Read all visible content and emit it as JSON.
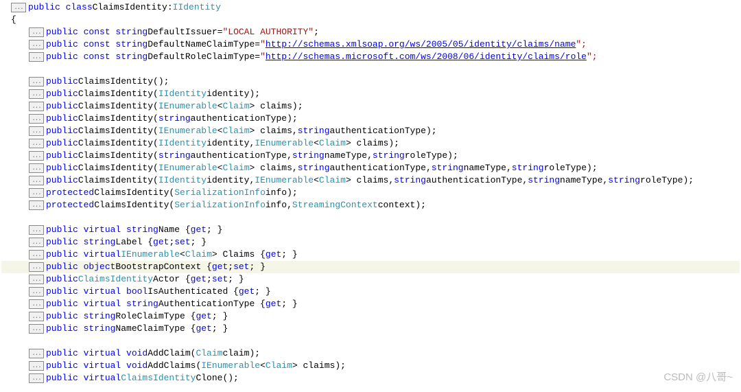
{
  "fold_label": "...",
  "watermark": "CSDN @八哥~",
  "code": {
    "class_header": {
      "mod": "public class",
      "name": "ClaimsIdentity",
      "sep": ":",
      "iface": "IIdentity"
    },
    "brace_open": "{",
    "consts": [
      {
        "kw": "public const string",
        "name": "DefaultIssuer",
        "eq": " = ",
        "val_type": "str",
        "val": "\"LOCAL AUTHORITY\"",
        "end": ";"
      },
      {
        "kw": "public const string",
        "name": "DefaultNameClaimType",
        "eq": " = ",
        "quote": "\"",
        "link": "http://schemas.xmlsoap.org/ws/2005/05/identity/claims/name",
        "end": "\";"
      },
      {
        "kw": "public const string",
        "name": "DefaultRoleClaimType",
        "eq": " = ",
        "quote": "\"",
        "link": "http://schemas.microsoft.com/ws/2008/06/identity/claims/role",
        "end": "\";"
      }
    ],
    "ctors": [
      [
        {
          "kw": "public"
        },
        {
          "txt": " ClaimsIdentity();"
        }
      ],
      [
        {
          "kw": "public"
        },
        {
          "txt": " ClaimsIdentity("
        },
        {
          "typ": "IIdentity"
        },
        {
          "txt": " identity);"
        }
      ],
      [
        {
          "kw": "public"
        },
        {
          "txt": " ClaimsIdentity("
        },
        {
          "typ": "IEnumerable"
        },
        {
          "txt": "<"
        },
        {
          "typ": "Claim"
        },
        {
          "txt": "> claims);"
        }
      ],
      [
        {
          "kw": "public"
        },
        {
          "txt": " ClaimsIdentity("
        },
        {
          "kw": "string"
        },
        {
          "txt": " authenticationType);"
        }
      ],
      [
        {
          "kw": "public"
        },
        {
          "txt": " ClaimsIdentity("
        },
        {
          "typ": "IEnumerable"
        },
        {
          "txt": "<"
        },
        {
          "typ": "Claim"
        },
        {
          "txt": "> claims, "
        },
        {
          "kw": "string"
        },
        {
          "txt": " authenticationType);"
        }
      ],
      [
        {
          "kw": "public"
        },
        {
          "txt": " ClaimsIdentity("
        },
        {
          "typ": "IIdentity"
        },
        {
          "txt": " identity, "
        },
        {
          "typ": "IEnumerable"
        },
        {
          "txt": "<"
        },
        {
          "typ": "Claim"
        },
        {
          "txt": "> claims);"
        }
      ],
      [
        {
          "kw": "public"
        },
        {
          "txt": " ClaimsIdentity("
        },
        {
          "kw": "string"
        },
        {
          "txt": " authenticationType, "
        },
        {
          "kw": "string"
        },
        {
          "txt": " nameType, "
        },
        {
          "kw": "string"
        },
        {
          "txt": " roleType);"
        }
      ],
      [
        {
          "kw": "public"
        },
        {
          "txt": " ClaimsIdentity("
        },
        {
          "typ": "IEnumerable"
        },
        {
          "txt": "<"
        },
        {
          "typ": "Claim"
        },
        {
          "txt": "> claims, "
        },
        {
          "kw": "string"
        },
        {
          "txt": " authenticationType, "
        },
        {
          "kw": "string"
        },
        {
          "txt": " nameType, "
        },
        {
          "kw": "string"
        },
        {
          "txt": " roleType);"
        }
      ],
      [
        {
          "kw": "public"
        },
        {
          "txt": " ClaimsIdentity("
        },
        {
          "typ": "IIdentity"
        },
        {
          "txt": " identity, "
        },
        {
          "typ": "IEnumerable"
        },
        {
          "txt": "<"
        },
        {
          "typ": "Claim"
        },
        {
          "txt": "> claims, "
        },
        {
          "kw": "string"
        },
        {
          "txt": " authenticationType, "
        },
        {
          "kw": "string"
        },
        {
          "txt": " nameType, "
        },
        {
          "kw": "string"
        },
        {
          "txt": " roleType);"
        }
      ],
      [
        {
          "kw": "protected"
        },
        {
          "txt": " ClaimsIdentity("
        },
        {
          "typ": "SerializationInfo"
        },
        {
          "txt": " info);"
        }
      ],
      [
        {
          "kw": "protected"
        },
        {
          "txt": " ClaimsIdentity("
        },
        {
          "typ": "SerializationInfo"
        },
        {
          "txt": " info, "
        },
        {
          "typ": "StreamingContext"
        },
        {
          "txt": " context);"
        }
      ]
    ],
    "props": [
      [
        {
          "kw": "public virtual string"
        },
        {
          "txt": " Name { "
        },
        {
          "kw": "get"
        },
        {
          "txt": "; }"
        }
      ],
      [
        {
          "kw": "public string"
        },
        {
          "txt": " Label { "
        },
        {
          "kw": "get"
        },
        {
          "txt": "; "
        },
        {
          "kw": "set"
        },
        {
          "txt": "; }"
        }
      ],
      [
        {
          "kw": "public virtual "
        },
        {
          "typ": "IEnumerable"
        },
        {
          "txt": "<"
        },
        {
          "typ": "Claim"
        },
        {
          "txt": "> Claims { "
        },
        {
          "kw": "get"
        },
        {
          "txt": "; }"
        }
      ],
      [
        {
          "kw": "public object"
        },
        {
          "txt": " BootstrapContext { "
        },
        {
          "kw": "get"
        },
        {
          "txt": "; "
        },
        {
          "kw": "set"
        },
        {
          "txt": "; }"
        }
      ],
      [
        {
          "kw": "public "
        },
        {
          "typ": "ClaimsIdentity"
        },
        {
          "txt": " Actor { "
        },
        {
          "kw": "get"
        },
        {
          "txt": "; "
        },
        {
          "kw": "set"
        },
        {
          "txt": "; }"
        }
      ],
      [
        {
          "kw": "public virtual bool"
        },
        {
          "txt": " IsAuthenticated { "
        },
        {
          "kw": "get"
        },
        {
          "txt": "; }"
        }
      ],
      [
        {
          "kw": "public virtual string"
        },
        {
          "txt": " AuthenticationType { "
        },
        {
          "kw": "get"
        },
        {
          "txt": "; }"
        }
      ],
      [
        {
          "kw": "public string"
        },
        {
          "txt": " RoleClaimType { "
        },
        {
          "kw": "get"
        },
        {
          "txt": "; }"
        }
      ],
      [
        {
          "kw": "public string"
        },
        {
          "txt": " NameClaimType { "
        },
        {
          "kw": "get"
        },
        {
          "txt": "; }"
        }
      ]
    ],
    "methods": [
      [
        {
          "kw": "public virtual void"
        },
        {
          "txt": " AddClaim("
        },
        {
          "typ": "Claim"
        },
        {
          "txt": " claim);"
        }
      ],
      [
        {
          "kw": "public virtual void"
        },
        {
          "txt": " AddClaims("
        },
        {
          "typ": "IEnumerable"
        },
        {
          "txt": "<"
        },
        {
          "typ": "Claim"
        },
        {
          "txt": "> claims);"
        }
      ],
      [
        {
          "kw": "public virtual "
        },
        {
          "typ": "ClaimsIdentity"
        },
        {
          "txt": " Clone();"
        }
      ]
    ],
    "highlight_prop_index": 3
  }
}
